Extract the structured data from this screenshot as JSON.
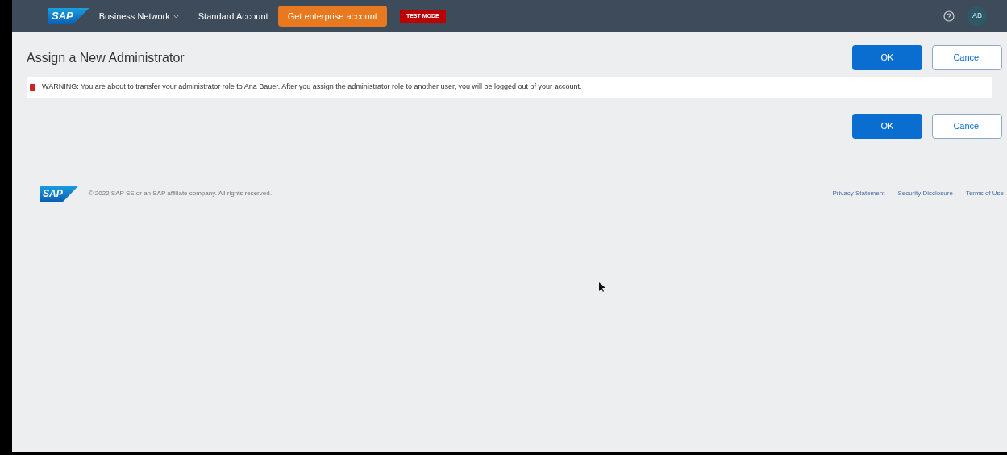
{
  "header": {
    "logo": "SAP",
    "product": "Business Network",
    "account": "Standard Account",
    "upgrade_button": "Get enterprise account",
    "mode_badge": "TEST MODE",
    "avatar": "AB"
  },
  "page": {
    "title": "Assign a New Administrator",
    "top_buttons": [
      "OK",
      "Cancel"
    ],
    "warning": "WARNING: You are about to transfer your administrator role to Ana Bauer. After you assign the administrator role to another user, you will be logged out of your account.",
    "bottom_buttons": [
      "OK",
      "Cancel"
    ]
  },
  "footer": {
    "logo": "SAP",
    "copyright": "© 2022 SAP SE or an SAP affiliate company. All rights reserved.",
    "links": [
      "Privacy Statement",
      "Security Disclosure",
      "Terms of Use"
    ]
  }
}
